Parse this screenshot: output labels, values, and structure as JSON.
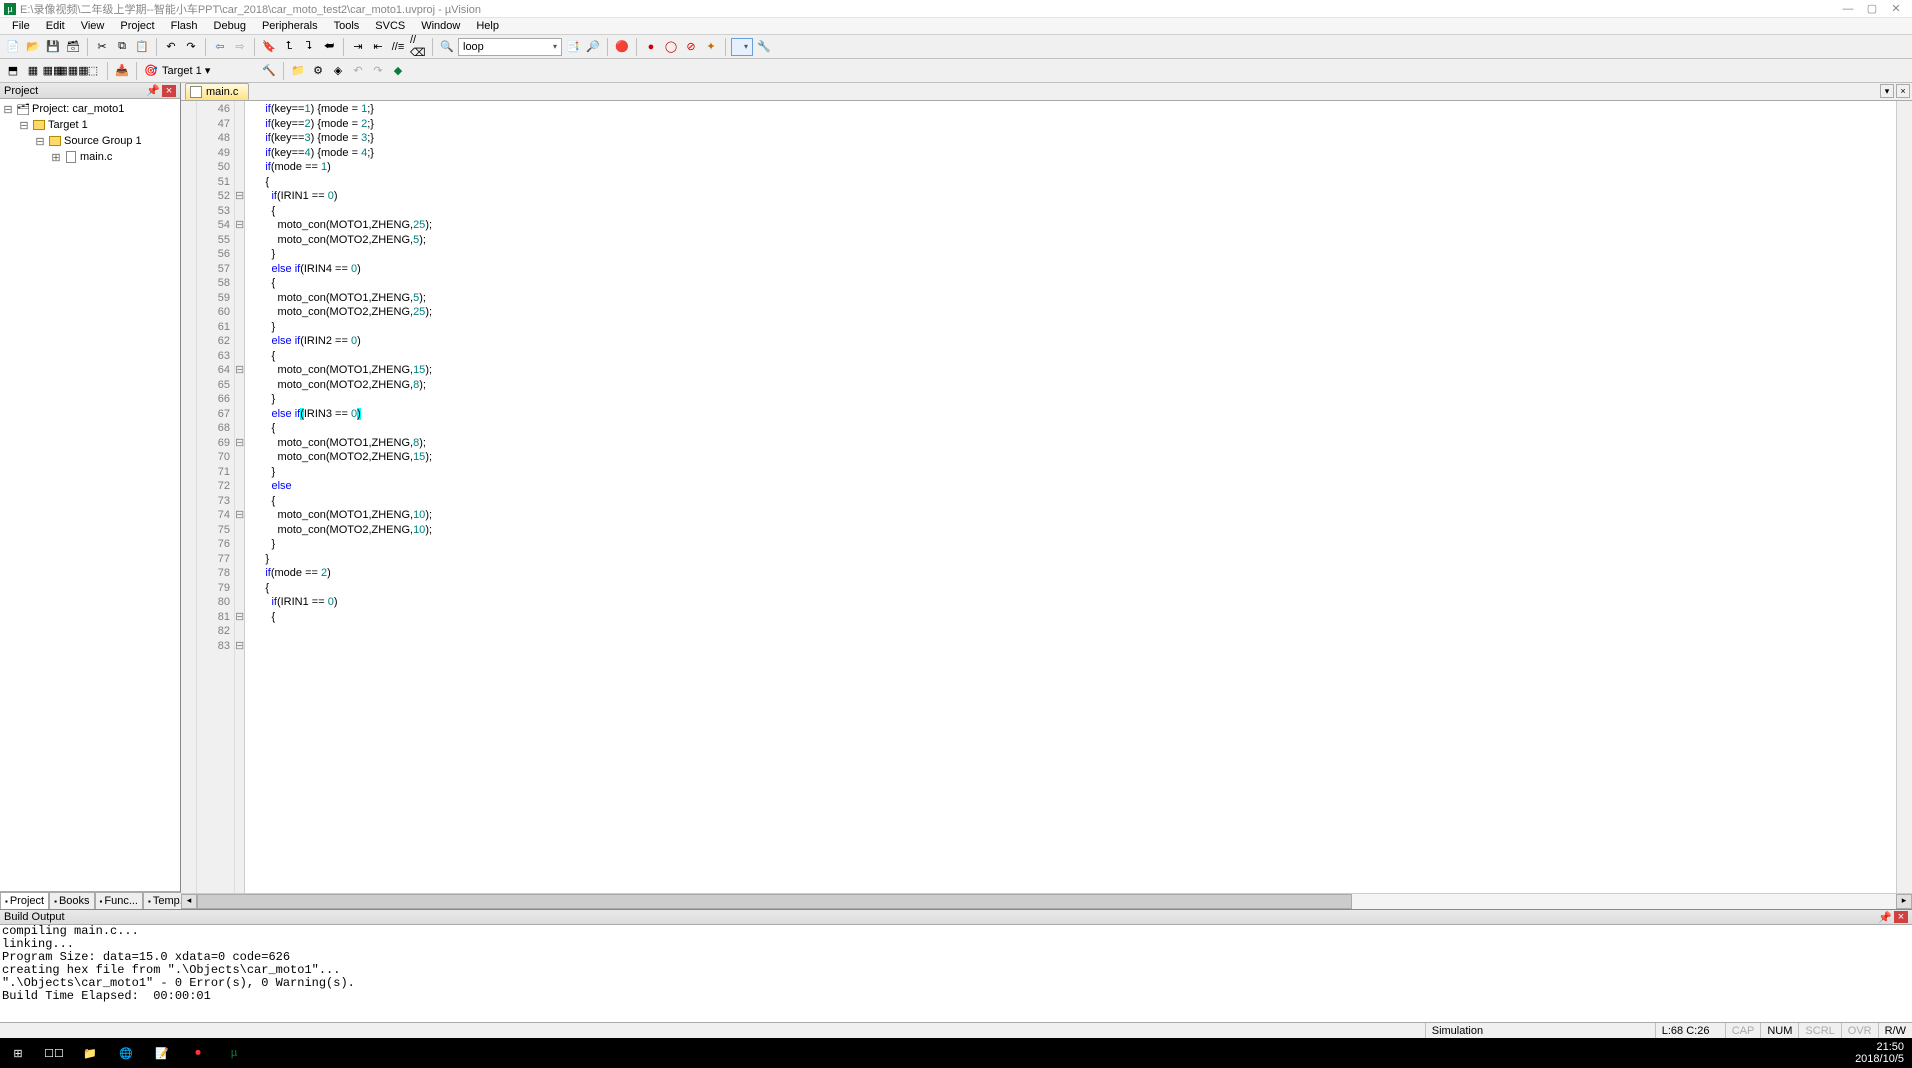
{
  "window": {
    "title": "E:\\录像视频\\二年级上学期--智能小车PPT\\car_2018\\car_moto_test2\\car_moto1.uvproj - µVision",
    "min": "—",
    "max": "▢",
    "close": "✕"
  },
  "menu": [
    "File",
    "Edit",
    "View",
    "Project",
    "Flash",
    "Debug",
    "Peripherals",
    "Tools",
    "SVCS",
    "Window",
    "Help"
  ],
  "toolbar": {
    "find_value": "loop"
  },
  "target": {
    "label": "Target 1"
  },
  "project_panel": {
    "title": "Project",
    "root": "Project: car_moto1",
    "target": "Target 1",
    "group": "Source Group 1",
    "file": "main.c",
    "tabs": [
      "Project",
      "Books",
      "Func...",
      "Temp..."
    ]
  },
  "editor": {
    "tab_file": "main.c",
    "first_line": 46,
    "last_line": 83,
    "fold_lines": [
      52,
      54,
      64,
      69,
      74,
      81,
      83
    ],
    "cursor_line": 68,
    "cursor_highlight_open": "(",
    "cursor_highlight_close": ")",
    "code": [
      {
        "indent": "      ",
        "tokens": [
          {
            "t": "if",
            "c": "kw"
          },
          {
            "t": "(key=="
          },
          {
            "t": "1",
            "c": "num"
          },
          {
            "t": ") {mode = "
          },
          {
            "t": "1",
            "c": "num"
          },
          {
            "t": ";}"
          }
        ]
      },
      {
        "indent": "      ",
        "tokens": [
          {
            "t": "if",
            "c": "kw"
          },
          {
            "t": "(key=="
          },
          {
            "t": "2",
            "c": "num"
          },
          {
            "t": ") {mode = "
          },
          {
            "t": "2",
            "c": "num"
          },
          {
            "t": ";}"
          }
        ]
      },
      {
        "indent": "      ",
        "tokens": [
          {
            "t": "if",
            "c": "kw"
          },
          {
            "t": "(key=="
          },
          {
            "t": "3",
            "c": "num"
          },
          {
            "t": ") {mode = "
          },
          {
            "t": "3",
            "c": "num"
          },
          {
            "t": ";}"
          }
        ]
      },
      {
        "indent": "      ",
        "tokens": [
          {
            "t": "if",
            "c": "kw"
          },
          {
            "t": "(key=="
          },
          {
            "t": "4",
            "c": "num"
          },
          {
            "t": ") {mode = "
          },
          {
            "t": "4",
            "c": "num"
          },
          {
            "t": ";}"
          }
        ]
      },
      {
        "indent": "",
        "tokens": []
      },
      {
        "indent": "      ",
        "tokens": [
          {
            "t": "if",
            "c": "kw"
          },
          {
            "t": "(mode == "
          },
          {
            "t": "1",
            "c": "num"
          },
          {
            "t": ")"
          }
        ]
      },
      {
        "indent": "      ",
        "tokens": [
          {
            "t": "{"
          }
        ]
      },
      {
        "indent": "        ",
        "tokens": [
          {
            "t": "if",
            "c": "kw"
          },
          {
            "t": "(IRIN1 == "
          },
          {
            "t": "0",
            "c": "num"
          },
          {
            "t": ")"
          }
        ]
      },
      {
        "indent": "        ",
        "tokens": [
          {
            "t": "{"
          }
        ]
      },
      {
        "indent": "          ",
        "tokens": [
          {
            "t": "moto_con(MOTO1,ZHENG,"
          },
          {
            "t": "25",
            "c": "num"
          },
          {
            "t": ");"
          }
        ]
      },
      {
        "indent": "          ",
        "tokens": [
          {
            "t": "moto_con(MOTO2,ZHENG,"
          },
          {
            "t": "5",
            "c": "num"
          },
          {
            "t": ");"
          }
        ]
      },
      {
        "indent": "        ",
        "tokens": [
          {
            "t": "}"
          }
        ]
      },
      {
        "indent": "        ",
        "tokens": [
          {
            "t": "else if",
            "c": "kw"
          },
          {
            "t": "(IRIN4 == "
          },
          {
            "t": "0",
            "c": "num"
          },
          {
            "t": ")"
          }
        ]
      },
      {
        "indent": "        ",
        "tokens": [
          {
            "t": "{"
          }
        ]
      },
      {
        "indent": "          ",
        "tokens": [
          {
            "t": "moto_con(MOTO1,ZHENG,"
          },
          {
            "t": "5",
            "c": "num"
          },
          {
            "t": ");"
          }
        ]
      },
      {
        "indent": "          ",
        "tokens": [
          {
            "t": "moto_con(MOTO2,ZHENG,"
          },
          {
            "t": "25",
            "c": "num"
          },
          {
            "t": ");"
          }
        ]
      },
      {
        "indent": "        ",
        "tokens": [
          {
            "t": "}"
          }
        ]
      },
      {
        "indent": "        ",
        "tokens": [
          {
            "t": "else if",
            "c": "kw"
          },
          {
            "t": "(IRIN2 == "
          },
          {
            "t": "0",
            "c": "num"
          },
          {
            "t": ")"
          }
        ]
      },
      {
        "indent": "        ",
        "tokens": [
          {
            "t": "{"
          }
        ]
      },
      {
        "indent": "          ",
        "tokens": [
          {
            "t": "moto_con(MOTO1,ZHENG,"
          },
          {
            "t": "15",
            "c": "num"
          },
          {
            "t": ");"
          }
        ]
      },
      {
        "indent": "          ",
        "tokens": [
          {
            "t": "moto_con(MOTO2,ZHENG,"
          },
          {
            "t": "8",
            "c": "num"
          },
          {
            "t": ");"
          }
        ]
      },
      {
        "indent": "        ",
        "tokens": [
          {
            "t": "}"
          }
        ]
      },
      {
        "indent": "        ",
        "tokens": [
          {
            "t": "else if",
            "c": "kw"
          },
          {
            "t": "(",
            "c": "hl"
          },
          {
            "t": "IRIN3 == "
          },
          {
            "t": "0",
            "c": "num"
          },
          {
            "t": ")",
            "c": "hl"
          }
        ]
      },
      {
        "indent": "        ",
        "tokens": [
          {
            "t": "{"
          }
        ]
      },
      {
        "indent": "          ",
        "tokens": [
          {
            "t": "moto_con(MOTO1,ZHENG,"
          },
          {
            "t": "8",
            "c": "num"
          },
          {
            "t": ");"
          }
        ]
      },
      {
        "indent": "          ",
        "tokens": [
          {
            "t": "moto_con(MOTO2,ZHENG,"
          },
          {
            "t": "15",
            "c": "num"
          },
          {
            "t": ");"
          }
        ]
      },
      {
        "indent": "        ",
        "tokens": [
          {
            "t": "}"
          }
        ]
      },
      {
        "indent": "        ",
        "tokens": [
          {
            "t": "else",
            "c": "kw"
          }
        ]
      },
      {
        "indent": "        ",
        "tokens": [
          {
            "t": "{"
          }
        ]
      },
      {
        "indent": "          ",
        "tokens": [
          {
            "t": "moto_con(MOTO1,ZHENG,"
          },
          {
            "t": "10",
            "c": "num"
          },
          {
            "t": ");"
          }
        ]
      },
      {
        "indent": "          ",
        "tokens": [
          {
            "t": "moto_con(MOTO2,ZHENG,"
          },
          {
            "t": "10",
            "c": "num"
          },
          {
            "t": ");"
          }
        ]
      },
      {
        "indent": "        ",
        "tokens": [
          {
            "t": "}"
          }
        ]
      },
      {
        "indent": "      ",
        "tokens": [
          {
            "t": "}"
          }
        ]
      },
      {
        "indent": "",
        "tokens": []
      },
      {
        "indent": "      ",
        "tokens": [
          {
            "t": "if",
            "c": "kw"
          },
          {
            "t": "(mode == "
          },
          {
            "t": "2",
            "c": "num"
          },
          {
            "t": ")"
          }
        ]
      },
      {
        "indent": "      ",
        "tokens": [
          {
            "t": "{"
          }
        ]
      },
      {
        "indent": "        ",
        "tokens": [
          {
            "t": "if",
            "c": "kw"
          },
          {
            "t": "(IRIN1 == "
          },
          {
            "t": "0",
            "c": "num"
          },
          {
            "t": ")"
          }
        ]
      },
      {
        "indent": "        ",
        "tokens": [
          {
            "t": "{"
          }
        ]
      }
    ]
  },
  "build": {
    "title": "Build Output",
    "lines": [
      "compiling main.c...",
      "linking...",
      "Program Size: data=15.0 xdata=0 code=626",
      "creating hex file from \".\\Objects\\car_moto1\"...",
      "\".\\Objects\\car_moto1\" - 0 Error(s), 0 Warning(s).",
      "Build Time Elapsed:  00:00:01"
    ]
  },
  "status": {
    "sim": "Simulation",
    "cursor": "L:68 C:26",
    "caps": "CAP",
    "num": "NUM",
    "scrl": "SCRL",
    "ovr": "OVR",
    "rw": "R/W"
  },
  "taskbar": {
    "time": "21:50",
    "date": "2018/10/5"
  }
}
